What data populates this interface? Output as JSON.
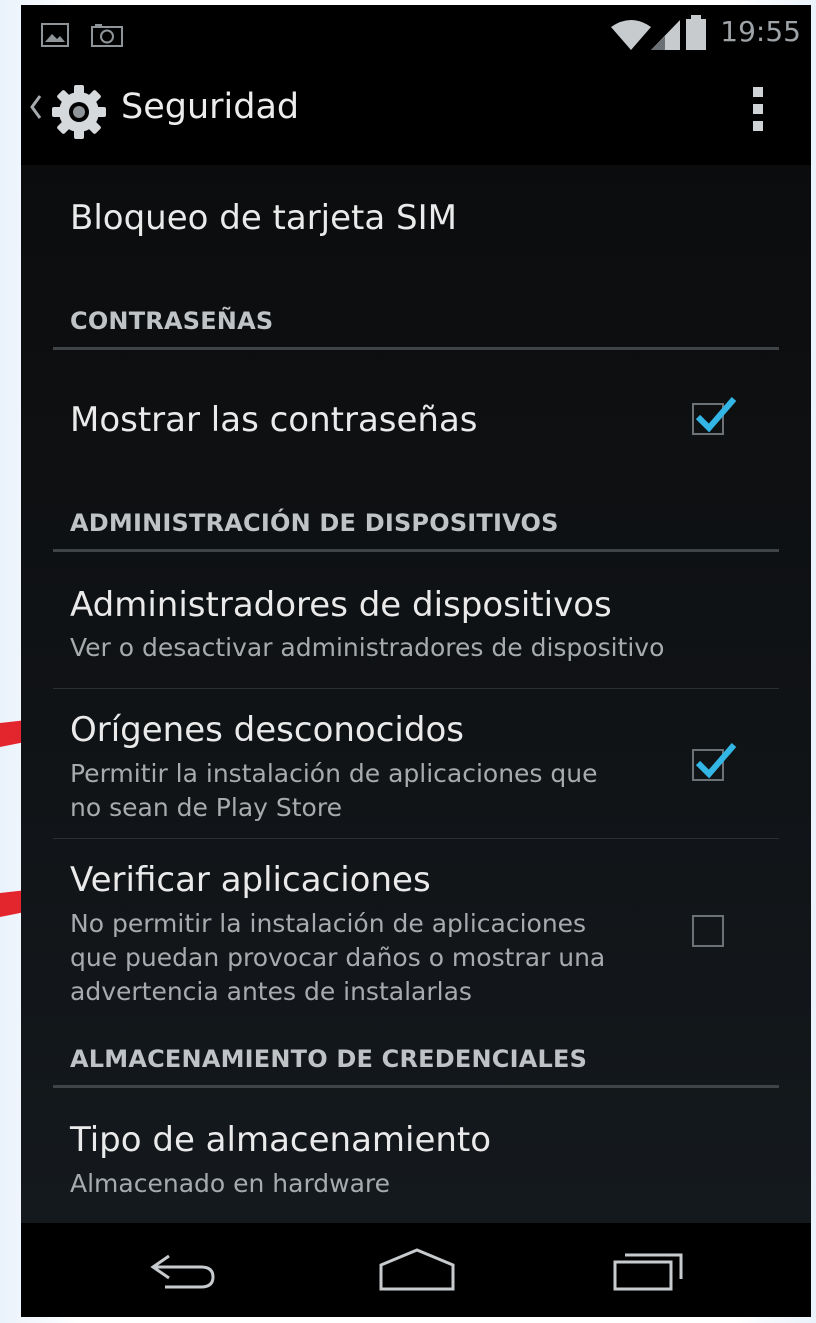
{
  "status_bar": {
    "time": "19:55",
    "icons": [
      "image-icon",
      "camera-icon",
      "wifi-icon",
      "signal-icon",
      "battery-icon"
    ]
  },
  "action_bar": {
    "title": "Seguridad",
    "icons": [
      "back-caret-icon",
      "settings-gear-icon",
      "overflow-menu-icon"
    ]
  },
  "settings": {
    "sim_lock": {
      "title": "Bloqueo de tarjeta SIM"
    },
    "passwords_section": "CONTRASEÑAS",
    "show_passwords": {
      "title": "Mostrar las contraseñas",
      "checked": true
    },
    "device_admin_section": "ADMINISTRACIÓN DE DISPOSITIVOS",
    "device_admins": {
      "title": "Administradores de dispositivos",
      "subtitle": "Ver o desactivar administradores de dispositivo"
    },
    "unknown_sources": {
      "title": "Orígenes desconocidos",
      "subtitle_line1": "Permitir la instalación de aplicaciones que",
      "subtitle_line2": "no sean de Play Store",
      "checked": true
    },
    "verify_apps": {
      "title": "Verificar aplicaciones",
      "subtitle_line1": "No permitir la instalación de aplicaciones",
      "subtitle_line2": "que puedan provocar daños o mostrar una",
      "subtitle_line3": "advertencia antes de instalarlas",
      "checked": false
    },
    "credential_section": "ALMACENAMIENTO DE CREDENCIALES",
    "storage_type": {
      "title": "Tipo de almacenamiento",
      "subtitle": "Almacenado en hardware"
    }
  },
  "nav_bar": {
    "icons": [
      "back-icon",
      "home-icon",
      "recent-apps-icon"
    ]
  },
  "colors": {
    "accent_check": "#33b5e5",
    "annotation_arrow": "#e3262e",
    "background": "#101316"
  }
}
